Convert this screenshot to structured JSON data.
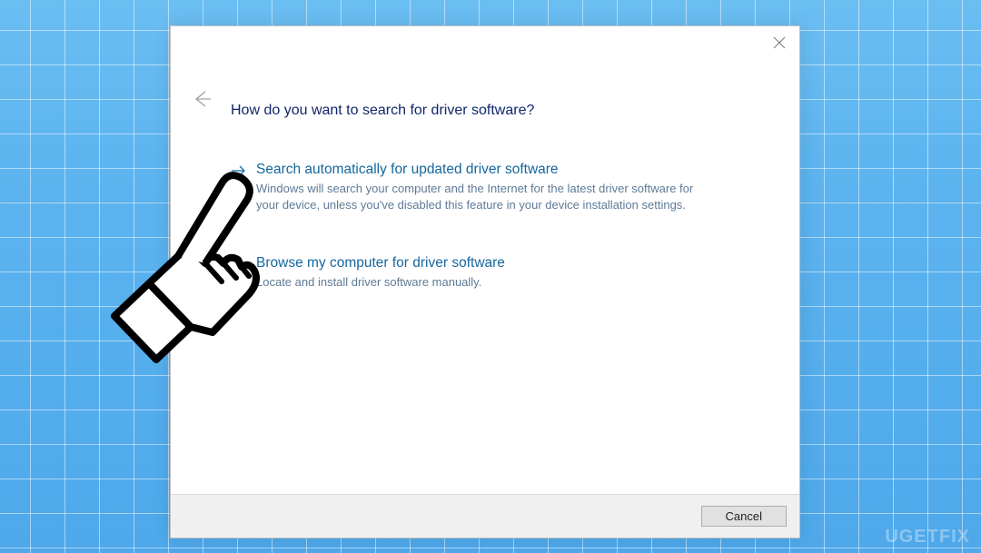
{
  "dialog": {
    "heading": "How do you want to search for driver software?",
    "options": [
      {
        "title": "Search automatically for updated driver software",
        "desc": "Windows will search your computer and the Internet for the latest driver software for your device, unless you've disabled this feature in your device installation settings."
      },
      {
        "title": "Browse my computer for driver software",
        "desc": "Locate and install driver software manually."
      }
    ],
    "cancel_label": "Cancel"
  },
  "watermark": "UGETFIX"
}
